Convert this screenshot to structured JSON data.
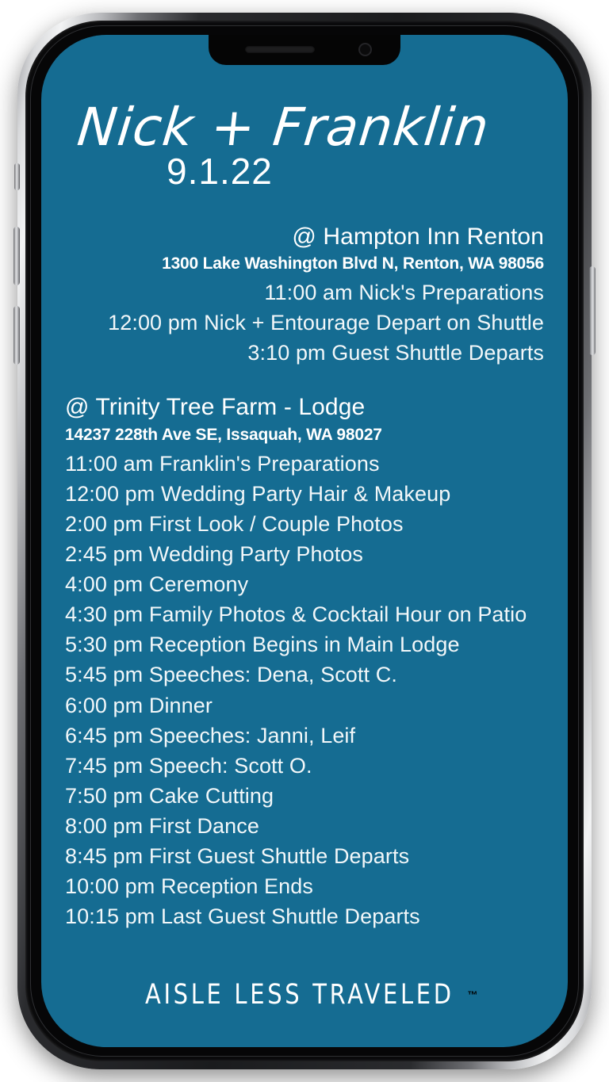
{
  "device": {
    "type": "smartphone-mockup",
    "notch": {
      "speaker": "earpiece-speaker",
      "camera": "front-camera"
    },
    "buttons": [
      "mute-switch",
      "volume-up",
      "volume-down",
      "power"
    ]
  },
  "colors": {
    "screen_background": "#156C92",
    "text": "#FFFFFF",
    "frame_metal": "#D9DADC",
    "frame_body": "#0A0A0B"
  },
  "header": {
    "couple_names": "Nick + Franklin",
    "wedding_date": "9.1.22"
  },
  "venues": [
    {
      "align": "right",
      "name": "@ Hampton Inn Renton",
      "address": "1300 Lake Washington Blvd N, Renton, WA 98056",
      "schedule": [
        "11:00 am Nick's Preparations",
        "12:00 pm Nick + Entourage Depart on Shuttle",
        "3:10 pm Guest Shuttle Departs"
      ]
    },
    {
      "align": "left",
      "name": "@ Trinity Tree Farm - Lodge",
      "address": "14237 228th Ave SE, Issaquah, WA 98027",
      "schedule": [
        "11:00 am Franklin's Preparations",
        "12:00 pm Wedding Party Hair & Makeup",
        "2:00 pm First Look / Couple Photos",
        "2:45 pm Wedding Party Photos",
        "4:00 pm Ceremony",
        "4:30 pm Family Photos & Cocktail Hour on Patio",
        "5:30 pm Reception Begins in Main Lodge",
        "5:45 pm Speeches: Dena, Scott C.",
        "6:00 pm Dinner",
        "6:45 pm Speeches: Janni, Leif",
        "7:45 pm Speech: Scott O.",
        "7:50 pm Cake Cutting",
        "8:00 pm First Dance",
        "8:45 pm First Guest Shuttle Departs",
        "10:00 pm Reception Ends",
        "10:15 pm Last Guest Shuttle Departs"
      ]
    }
  ],
  "brand": {
    "name": "AISLE LESS TRAVELED",
    "trademark": "™"
  }
}
